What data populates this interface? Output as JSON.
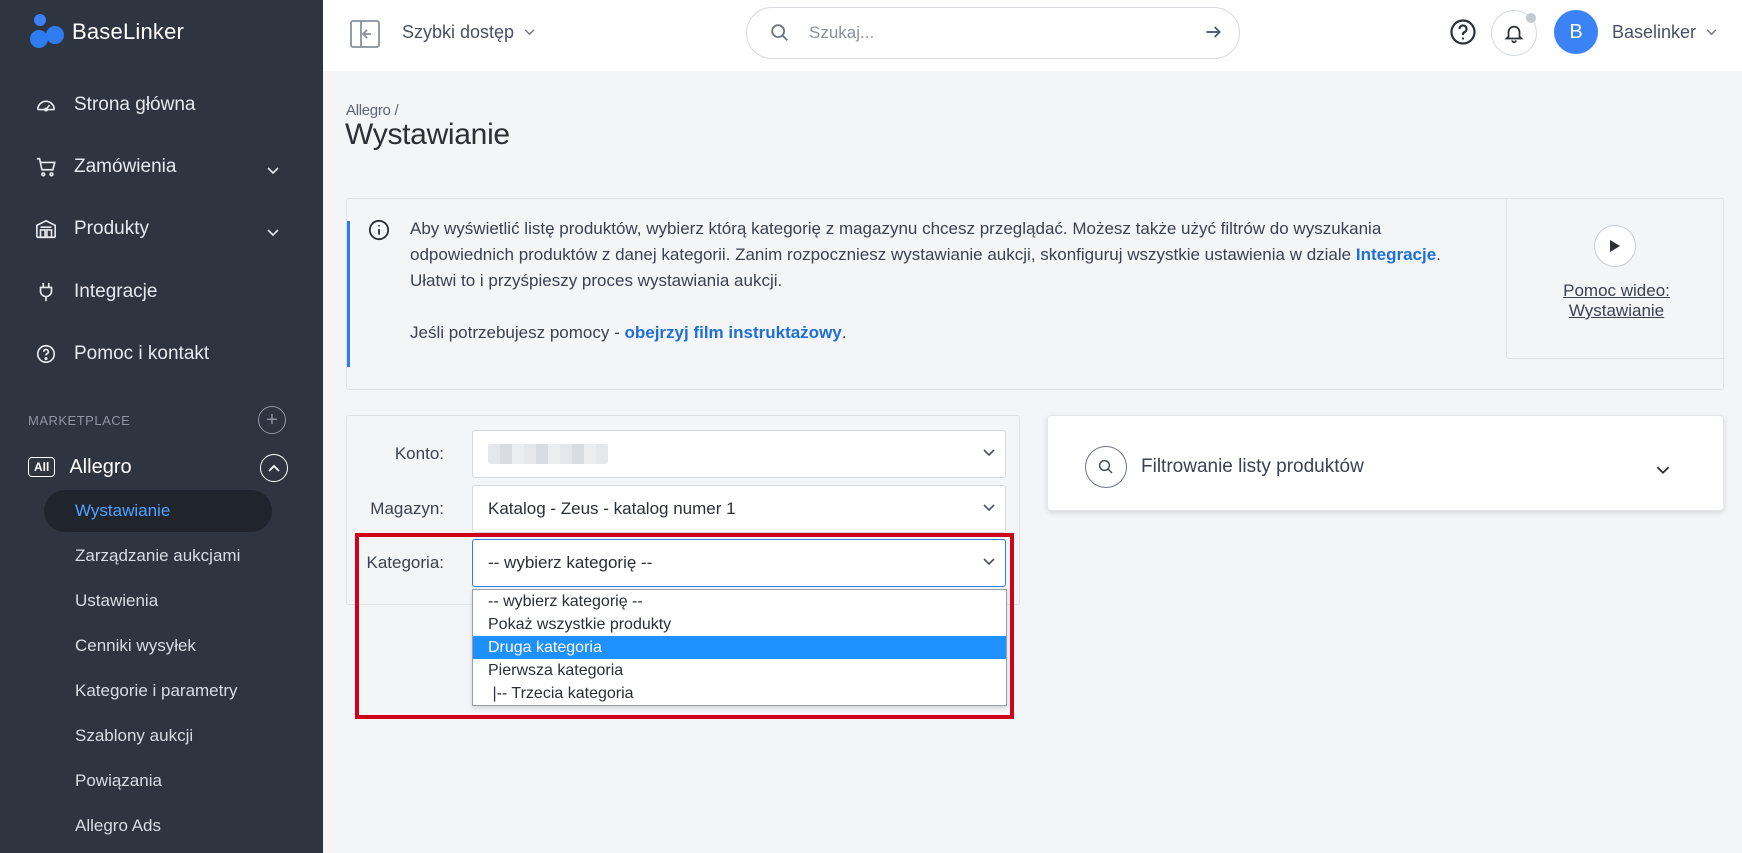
{
  "app": {
    "brand": "BaseLinker"
  },
  "sidebar": {
    "items": [
      {
        "label": "Strona główna",
        "icon": "dashboard-icon",
        "has_chevron": false
      },
      {
        "label": "Zamówienia",
        "icon": "cart-icon",
        "has_chevron": true
      },
      {
        "label": "Produkty",
        "icon": "warehouse-icon",
        "has_chevron": true
      },
      {
        "label": "Integracje",
        "icon": "plug-icon",
        "has_chevron": false
      },
      {
        "label": "Pomoc i kontakt",
        "icon": "help-circle-icon",
        "has_chevron": false
      }
    ],
    "section_label": "MARKETPLACE",
    "marketplace": {
      "badge": "All",
      "label": "Allegro",
      "subitems": [
        {
          "label": "Wystawianie",
          "active": true
        },
        {
          "label": "Zarządzanie aukcjami",
          "active": false
        },
        {
          "label": "Ustawienia",
          "active": false
        },
        {
          "label": "Cenniki wysyłek",
          "active": false
        },
        {
          "label": "Kategorie i parametry",
          "active": false
        },
        {
          "label": "Szablony aukcji",
          "active": false
        },
        {
          "label": "Powiązania",
          "active": false
        },
        {
          "label": "Allegro Ads",
          "active": false
        }
      ]
    }
  },
  "topbar": {
    "quick_access": "Szybki dostęp",
    "search_placeholder": "Szukaj...",
    "avatar_letter": "B",
    "user_name": "Baselinker"
  },
  "page": {
    "breadcrumb": "Allegro /",
    "title": "Wystawianie"
  },
  "info": {
    "text_before_link": "Aby wyświetlić listę produktów, wybierz którą kategorię z magazynu chcesz przeglądać. Możesz także użyć filtrów do wyszukania odpowiednich produktów z danej kategorii. Zanim rozpoczniesz wystawianie aukcji, skonfiguruj wszystkie ustawienia w dziale ",
    "link_integracje": "Integracje",
    "text_after_link": ". Ułatwi to i przyśpieszy proces wystawiania aukcji.",
    "help_text": "Jeśli potrzebujesz pomocy - ",
    "help_link": "obejrzyj film instruktażowy",
    "help_end": ".",
    "video_label_line1": "Pomoc wideo:",
    "video_label_line2": "Wystawianie"
  },
  "form": {
    "konto_label": "Konto:",
    "magazyn_label": "Magazyn:",
    "magazyn_value": "Katalog - Zeus - katalog numer 1",
    "kategoria_label": "Kategoria:",
    "kategoria_value": "-- wybierz kategorię --",
    "kategoria_options": [
      "-- wybierz kategorię --",
      "Pokaż wszystkie produkty",
      "Druga kategoria",
      "Pierwsza kategoria",
      " |-- Trzecia kategoria"
    ],
    "highlighted_option_index": 2
  },
  "filter": {
    "title": "Filtrowanie listy produktów"
  },
  "colors": {
    "sidebar_bg": "#2e3440",
    "accent": "#2f7bf0",
    "active_link": "#4da3ff",
    "highlight_frame": "#d0021b",
    "dropdown_selected": "#1e90ff"
  }
}
